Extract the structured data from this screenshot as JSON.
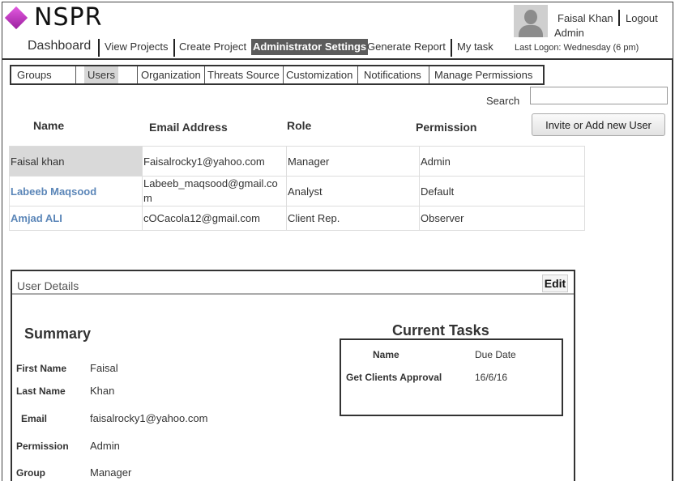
{
  "app": {
    "logo_text": "NSPR"
  },
  "nav": {
    "dashboard": "Dashboard",
    "view_projects": "View Projects",
    "create_project": "Create Project",
    "admin_settings": "Administrator Settings",
    "generate_report": "Generate Report",
    "my_task": "My task"
  },
  "user": {
    "name": "Faisal Khan",
    "logout": "Logout",
    "role": "Admin",
    "last_logon": "Last Logon:  Wednesday (6 pm)"
  },
  "tabs": [
    "Groups",
    "Users",
    "Organization",
    "Threats Source",
    "Customization",
    "Notifications",
    "Manage Permissions"
  ],
  "active_tab": "Users",
  "search": {
    "label": "Search",
    "value": ""
  },
  "invite_button": "Invite or Add new User",
  "table": {
    "headers": [
      "Name",
      "Email Address",
      "Role",
      "Permission"
    ],
    "rows": [
      {
        "name": "Faisal khan",
        "email": "Faisalrocky1@yahoo.com",
        "role": "Manager",
        "permission": "Admin"
      },
      {
        "name": "Labeeb Maqsood",
        "email": "Labeeb_maqsood@gmail.com",
        "role": "Analyst",
        "permission": "Default"
      },
      {
        "name": "Amjad ALI",
        "email": "cOCacola12@gmail.com",
        "role": "Client Rep.",
        "permission": "Observer"
      }
    ]
  },
  "details": {
    "title": "User Details",
    "edit": "Edit",
    "summary_heading": "Summary",
    "fields": [
      {
        "label": "First Name",
        "value": "Faisal"
      },
      {
        "label": "Last Name",
        "value": "Khan"
      },
      {
        "label": "Email",
        "value": "faisalrocky1@yahoo.com"
      },
      {
        "label": "Permission",
        "value": "Admin"
      },
      {
        "label": "Group",
        "value": "Manager"
      }
    ],
    "tasks_heading": "Current Tasks",
    "task_headers": {
      "name": "Name",
      "due": "Due Date"
    },
    "tasks": [
      {
        "name": "Get Clients Approval",
        "due": "16/6/16"
      }
    ]
  },
  "colors": {
    "link": "#5b86b8",
    "active_nav_bg": "#5c5c5c",
    "logo_purple": "#b23cb3"
  }
}
